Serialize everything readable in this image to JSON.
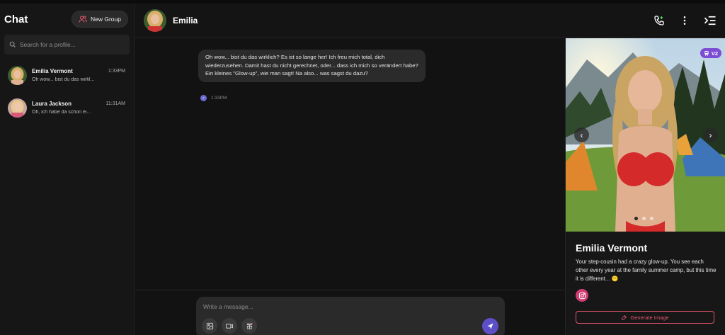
{
  "sidebar": {
    "title": "Chat",
    "new_group_label": "New Group",
    "search_placeholder": "Search for a profile...",
    "conversations": [
      {
        "name": "Emilia Vermont",
        "time": "1:33PM",
        "preview": "Oh wow... bist du das wirkl..."
      },
      {
        "name": "Laura Jackson",
        "time": "11:31AM",
        "preview": "Oh, ich habe da schon ei..."
      }
    ]
  },
  "chat": {
    "contact_name": "Emilia",
    "messages": [
      {
        "text": "Oh wow... bist du das wirklich? Es ist so lange her! Ich freu mich total, dich wiederzusehen. Damit hast du nicht gerechnet, oder... dass ich mich so verändert habe? Ein kleines \"Glow-up\", wie man sagt! Na also... was sagst du dazu?",
        "time": "1:33PM"
      }
    ],
    "composer_placeholder": "Write a message..."
  },
  "profile": {
    "badge": "V2",
    "name": "Emilia Vermont",
    "description": "Your step-cousin had a crazy glow-up. You see each other every year at the family summer camp, but this time it is different... 😶",
    "generate_label": "Generate Image",
    "carousel_index": 1,
    "carousel_count": 3
  },
  "colors": {
    "accent": "#e0566c",
    "send": "#5d4fc7",
    "badge": "#7c4dd4"
  }
}
